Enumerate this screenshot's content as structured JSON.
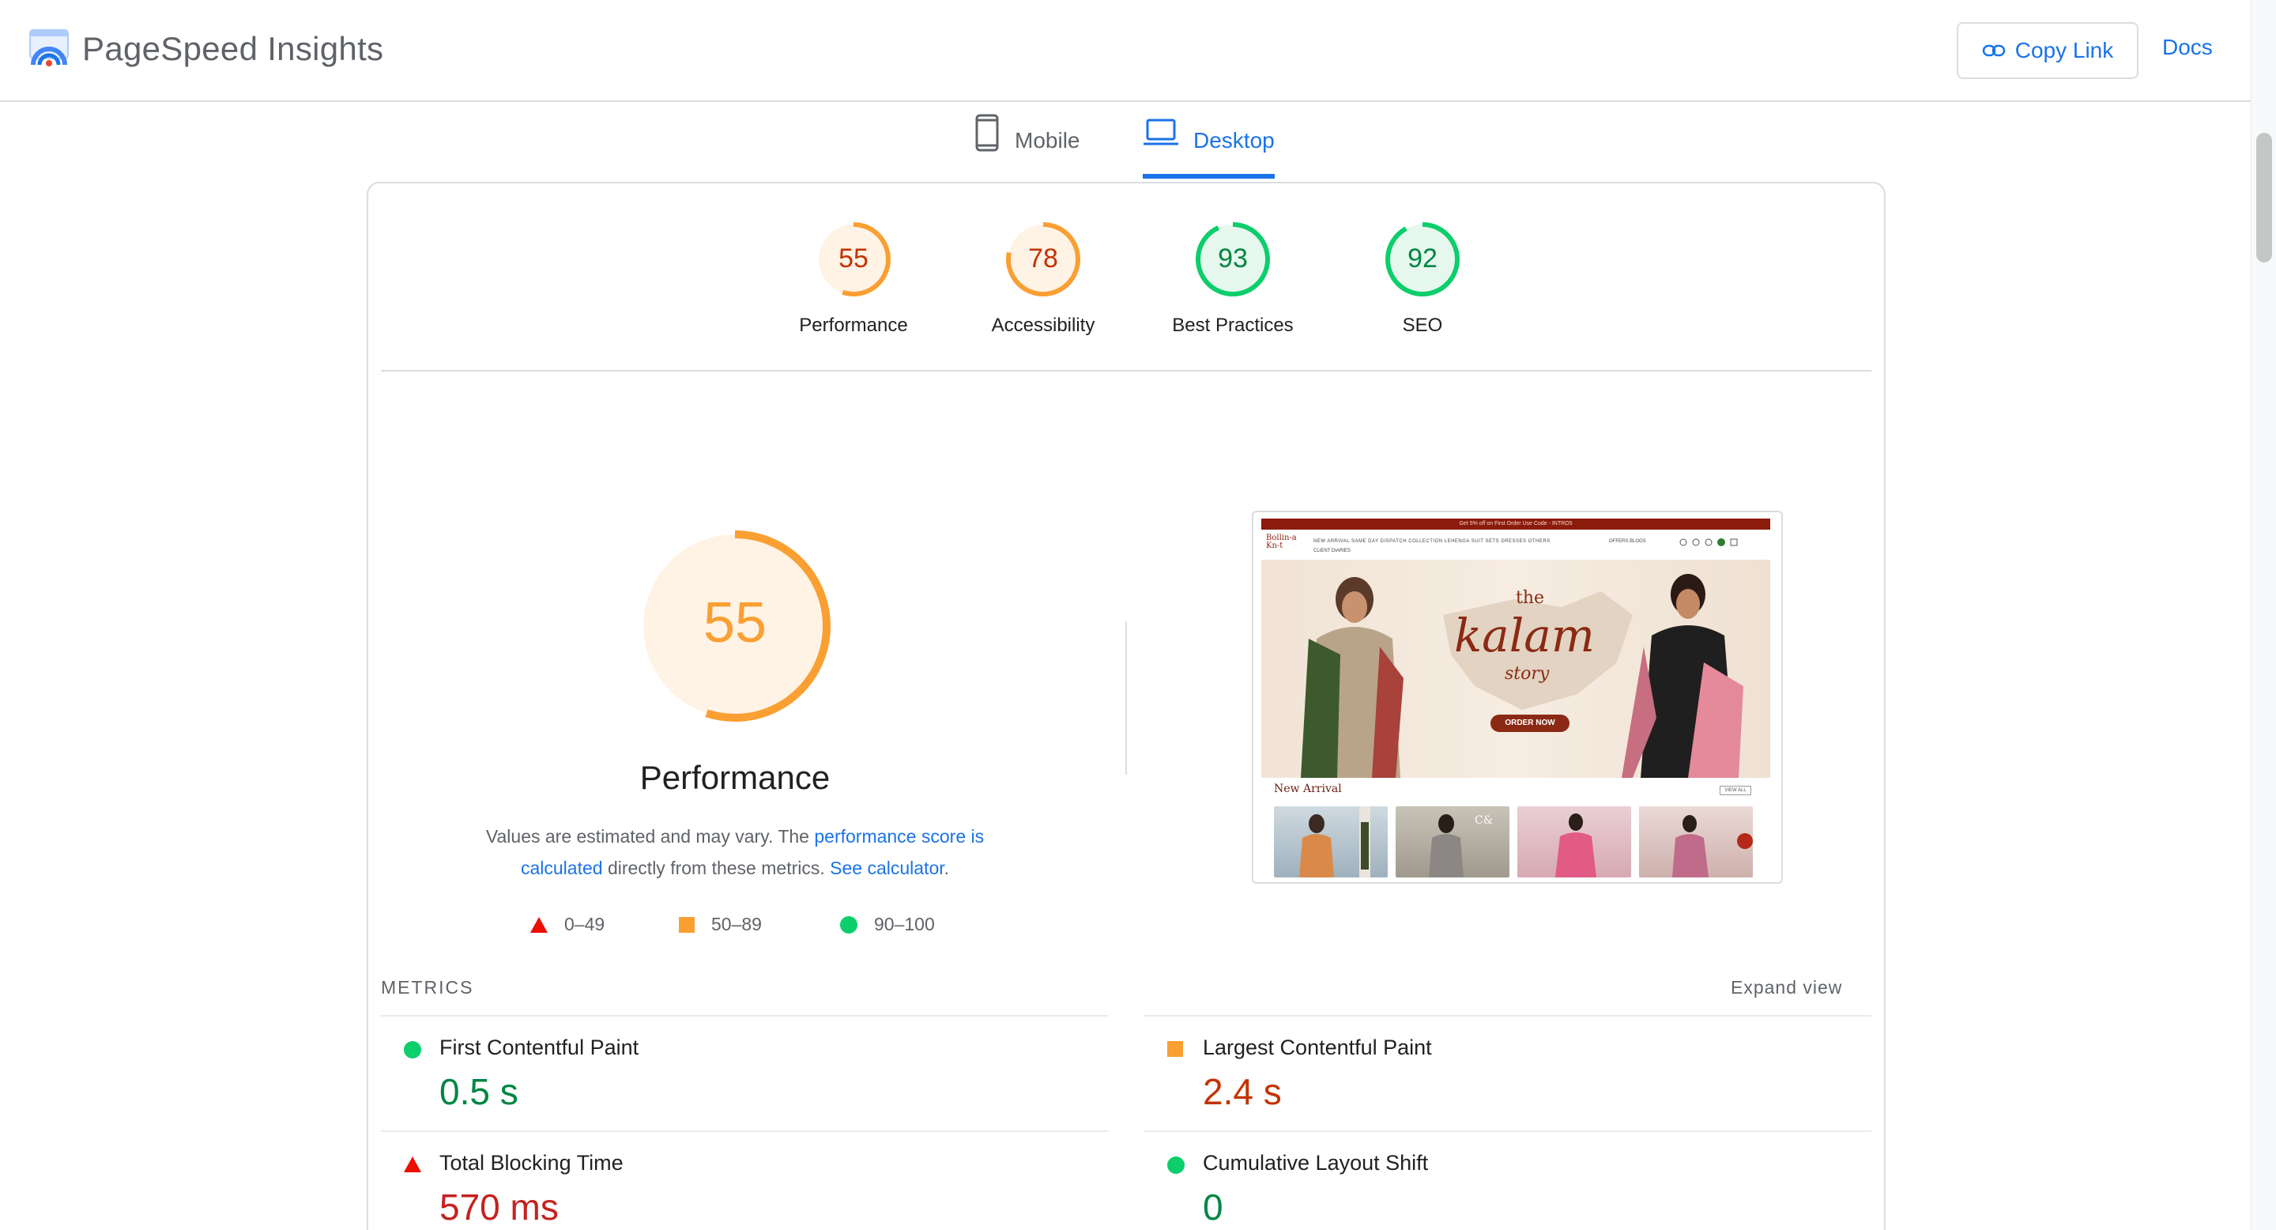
{
  "header": {
    "app_title": "PageSpeed Insights",
    "copy_link_label": "Copy Link",
    "docs_label": "Docs"
  },
  "tabs": [
    {
      "label": "Mobile",
      "active": false
    },
    {
      "label": "Desktop",
      "active": true
    }
  ],
  "scores": [
    {
      "value": "55",
      "label": "Performance",
      "fraction": 0.55,
      "status": "average"
    },
    {
      "value": "78",
      "label": "Accessibility",
      "fraction": 0.78,
      "status": "average"
    },
    {
      "value": "93",
      "label": "Best Practices",
      "fraction": 0.93,
      "status": "pass"
    },
    {
      "value": "92",
      "label": "SEO",
      "fraction": 0.92,
      "status": "pass"
    }
  ],
  "colors": {
    "fail": "#eb0f00",
    "average": "#fa9f32",
    "pass": "#0cce6b",
    "fail_text": "#c5221f",
    "average_text": "#c33300",
    "pass_text": "#018642",
    "link": "#1a73e8"
  },
  "performance": {
    "score": "55",
    "fraction": 0.55,
    "title": "Performance",
    "desc_1": "Values are estimated and may vary. The ",
    "link_score": "performance score is calculated",
    "desc_2": " directly from these metrics. ",
    "link_calc": "See calculator",
    "desc_3": "."
  },
  "legend": [
    {
      "icon": "red-triangle-icon",
      "range": "0–49"
    },
    {
      "icon": "orange-square-icon",
      "range": "50–89"
    },
    {
      "icon": "green-circle-icon",
      "range": "90–100"
    }
  ],
  "screenshot": {
    "banner": "Get 5% off on First Order Use Code - INTRO5",
    "logo_line1": "Bollin-a",
    "logo_line2": "Kn-t",
    "menu": "NEW ARRIVAL    SAME DAY DISPATCH    COLLECTION    LEHENGA    SUIT SETS    DRESSES    OTHERS",
    "menu2": "CLIENT DIARIES",
    "right_menu": "OFFERS    BLOGS",
    "hero_small": "the",
    "hero_title": "kalam",
    "hero_sub": "story",
    "hero_button": "ORDER NOW",
    "section_title": "New Arrival",
    "view_all": "VIEW ALL"
  },
  "metrics": {
    "heading": "METRICS",
    "expand_label": "Expand view",
    "items": [
      {
        "name": "First Contentful Paint",
        "value": "0.5 s",
        "status": "pass"
      },
      {
        "name": "Largest Contentful Paint",
        "value": "2.4 s",
        "status": "average"
      },
      {
        "name": "Total Blocking Time",
        "value": "570 ms",
        "status": "fail"
      },
      {
        "name": "Cumulative Layout Shift",
        "value": "0",
        "status": "pass"
      }
    ]
  }
}
